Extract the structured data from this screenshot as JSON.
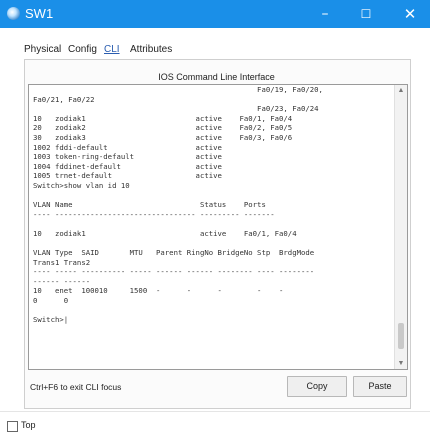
{
  "window": {
    "title": "SW1",
    "controls": {
      "minimize": "–",
      "maximize": "☐",
      "close": "✕"
    }
  },
  "tabs": [
    "Physical",
    "Config",
    "CLI",
    "Attributes"
  ],
  "active_tab": "CLI",
  "panel_title": "IOS Command Line Interface",
  "terminal": {
    "lines": [
      "                                                   Fa0/19, Fa0/20,",
      "Fa0/21, Fa0/22",
      "                                                   Fa0/23, Fa0/24",
      "10   zodiak1                         active    Fa0/1, Fa0/4",
      "20   zodiak2                         active    Fa0/2, Fa0/5",
      "30   zodiak3                         active    Fa0/3, Fa0/6",
      "1002 fddi-default                    active",
      "1003 token-ring-default              active",
      "1004 fddinet-default                 active",
      "1005 trnet-default                   active",
      "Switch>show vlan id 10",
      "",
      "VLAN Name                             Status    Ports",
      "---- -------------------------------- --------- -------",
      "",
      "10   zodiak1                          active    Fa0/1, Fa0/4",
      "",
      "VLAN Type  SAID       MTU   Parent RingNo BridgeNo Stp  BrdgMode",
      "Trans1 Trans2",
      "---- ----- ---------- ----- ------ ------ -------- ---- --------",
      "------ ------",
      "10   enet  100010     1500  -      -      -        -    -",
      "0      0",
      "",
      "Switch>|"
    ]
  },
  "footer": {
    "hint": "Ctrl+F6 to exit CLI focus",
    "copy_label": "Copy",
    "paste_label": "Paste"
  },
  "top_checkbox": {
    "label": "Top",
    "checked": false
  }
}
